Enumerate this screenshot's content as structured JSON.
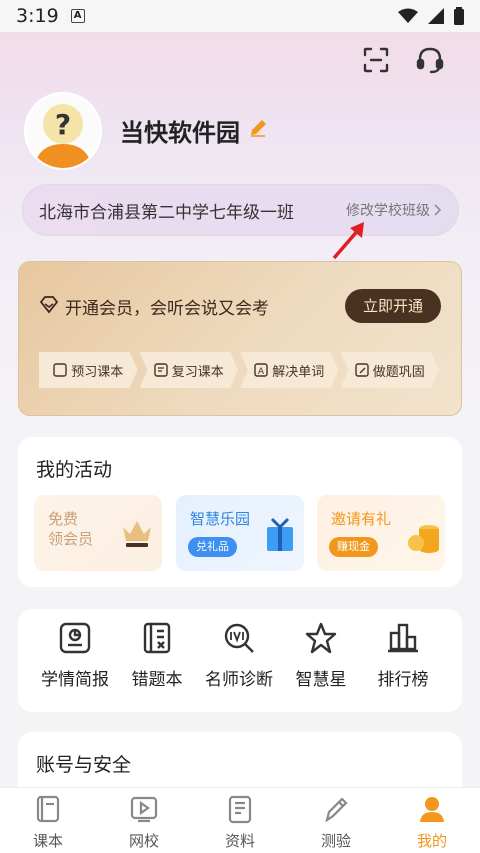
{
  "status_bar": {
    "time": "3:19",
    "notif_icon": "A"
  },
  "header": {
    "scan_icon": "scan-icon",
    "service_icon": "headset-icon"
  },
  "profile": {
    "name": "当快软件园",
    "edit_icon": "pencil-icon"
  },
  "school": {
    "name": "北海市合浦县第二中学七年级一班",
    "change_label": "修改学校班级"
  },
  "vip": {
    "title": "开通会员，会听会说又会考",
    "button": "立即开通",
    "steps": [
      "预习课本",
      "复习课本",
      "解决单词",
      "做题巩固"
    ]
  },
  "activities": {
    "title": "我的活动",
    "items": [
      {
        "line1": "免费",
        "line2": "领会员"
      },
      {
        "title": "智慧乐园",
        "pill": "兑礼品"
      },
      {
        "title": "邀请有礼",
        "pill": "赚现金"
      }
    ]
  },
  "tools": [
    {
      "label": "学情简报",
      "icon": "report-icon"
    },
    {
      "label": "错题本",
      "icon": "wrongbook-icon"
    },
    {
      "label": "名师诊断",
      "icon": "diagnose-icon"
    },
    {
      "label": "智慧星",
      "icon": "star-icon"
    },
    {
      "label": "排行榜",
      "icon": "ranking-icon"
    }
  ],
  "account": {
    "title": "账号与安全"
  },
  "tabs": [
    {
      "label": "课本",
      "icon": "book-icon"
    },
    {
      "label": "网校",
      "icon": "play-icon"
    },
    {
      "label": "资料",
      "icon": "document-icon"
    },
    {
      "label": "测验",
      "icon": "pen-icon"
    },
    {
      "label": "我的",
      "icon": "user-icon",
      "active": true
    }
  ],
  "colors": {
    "accent": "#f2971d",
    "vip_button": "#4a3223",
    "annotation_arrow": "#e02020"
  }
}
